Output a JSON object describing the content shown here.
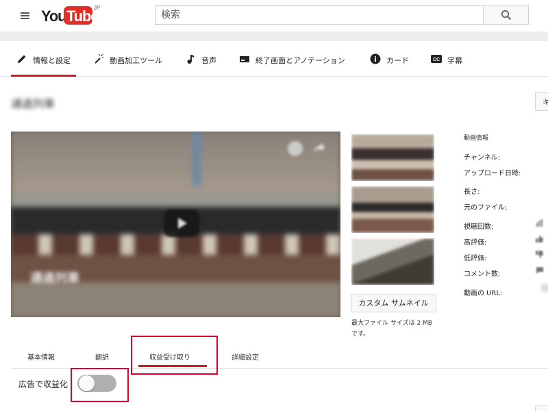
{
  "masthead": {
    "logo_you": "You",
    "logo_tube": "Tube",
    "logo_country": "JP",
    "search_placeholder": "検索"
  },
  "edit_tabs": [
    {
      "label": "情報と設定",
      "icon": "pencil-icon",
      "active": true
    },
    {
      "label": "動画加工ツール",
      "icon": "magic-wand-icon",
      "active": false
    },
    {
      "label": "音声",
      "icon": "music-note-icon",
      "active": false
    },
    {
      "label": "終了画面とアノテーション",
      "icon": "end-screen-icon",
      "active": false
    },
    {
      "label": "カード",
      "icon": "info-icon",
      "active": false
    },
    {
      "label": "字幕",
      "icon": "cc-icon",
      "active": false
    }
  ],
  "video": {
    "title": "通過列車",
    "overlay_title": "通過列車",
    "overlay_channel": "",
    "corner_button_label": "キ"
  },
  "thumbnails": {
    "custom_button_label": "カスタム サムネイル",
    "note": "最大ファイル サイズは 2 MB です。"
  },
  "video_info": {
    "heading": "動画情報",
    "rows": [
      {
        "label": "チャンネル:"
      },
      {
        "label": "アップロード日時:"
      },
      {
        "label": "長さ:"
      },
      {
        "label": "元のファイル:"
      },
      {
        "label": "視聴回数:",
        "icon": "bar-chart-icon"
      },
      {
        "label": "高評価:",
        "icon": "thumbs-up-icon"
      },
      {
        "label": "低評価:",
        "icon": "thumbs-down-icon"
      },
      {
        "label": "コメント数:",
        "icon": "comment-icon"
      },
      {
        "label": "動画の URL:"
      }
    ]
  },
  "sub_tabs": [
    {
      "label": "基本情報",
      "active": false
    },
    {
      "label": "翻訳",
      "active": false
    },
    {
      "label": "収益受け取り",
      "active": true
    },
    {
      "label": "詳細設定",
      "active": false
    }
  ],
  "monetization": {
    "label": "広告で収益化",
    "enabled": false
  },
  "colors": {
    "accent_red": "#cc181e",
    "highlight_red": "#e4002b",
    "toggle_off": "#b0b0b0"
  }
}
